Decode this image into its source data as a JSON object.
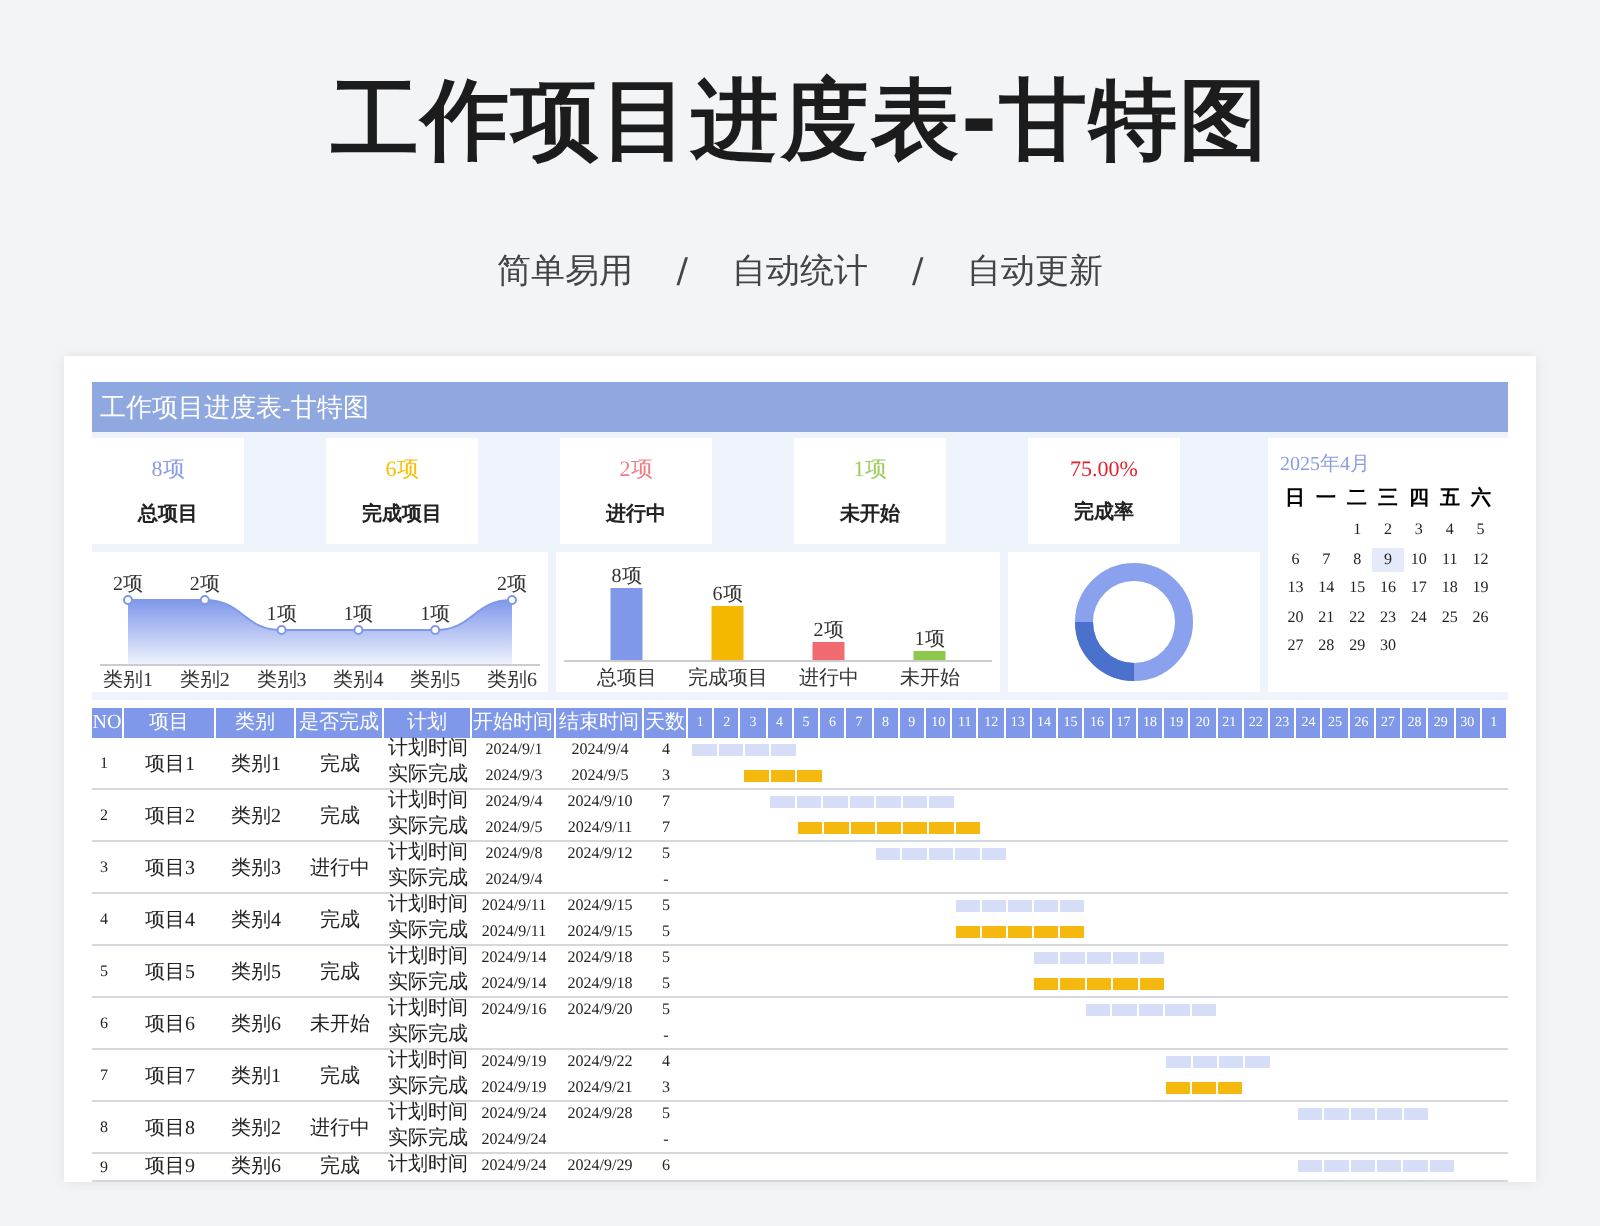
{
  "title": "工作项目进度表-甘特图",
  "subtitle": {
    "items": [
      "简单易用",
      "自动统计",
      "自动更新"
    ],
    "separator": "/"
  },
  "sheet_title": "工作项目进度表-甘特图",
  "stats": [
    {
      "value": "8项",
      "label": "总项目",
      "color": "#8c9be6"
    },
    {
      "value": "6项",
      "label": "完成项目",
      "color": "#f5c000"
    },
    {
      "value": "2项",
      "label": "进行中",
      "color": "#f07c86"
    },
    {
      "value": "1项",
      "label": "未开始",
      "color": "#9ccc5a"
    },
    {
      "value": "75.00%",
      "label": "完成率",
      "color": "#e0242c"
    }
  ],
  "calendar": {
    "title": "2025年4月",
    "weekdays": [
      "日",
      "一",
      "二",
      "三",
      "四",
      "五",
      "六"
    ],
    "weeks": [
      {
        "right_aligned": true,
        "days": [
          {
            "day": "1",
            "selected": false
          },
          {
            "day": "2",
            "selected": false
          },
          {
            "day": "3",
            "selected": false
          },
          {
            "day": "4",
            "selected": false
          },
          {
            "day": "5",
            "selected": false
          }
        ]
      },
      {
        "right_aligned": false,
        "days": [
          {
            "day": "6",
            "selected": false
          },
          {
            "day": "7",
            "selected": false
          },
          {
            "day": "8",
            "selected": false
          },
          {
            "day": "9",
            "selected": true
          },
          {
            "day": "10",
            "selected": false
          },
          {
            "day": "11",
            "selected": false
          },
          {
            "day": "12",
            "selected": false
          }
        ]
      },
      {
        "right_aligned": false,
        "days": [
          {
            "day": "13",
            "selected": false
          },
          {
            "day": "14",
            "selected": false
          },
          {
            "day": "15",
            "selected": false
          },
          {
            "day": "16",
            "selected": false
          },
          {
            "day": "17",
            "selected": false
          },
          {
            "day": "18",
            "selected": false
          },
          {
            "day": "19",
            "selected": false
          }
        ]
      },
      {
        "right_aligned": false,
        "days": [
          {
            "day": "20",
            "selected": false
          },
          {
            "day": "21",
            "selected": false
          },
          {
            "day": "22",
            "selected": false
          },
          {
            "day": "23",
            "selected": false
          },
          {
            "day": "24",
            "selected": false
          },
          {
            "day": "25",
            "selected": false
          },
          {
            "day": "26",
            "selected": false
          }
        ]
      },
      {
        "right_aligned": false,
        "days": [
          {
            "day": "27",
            "selected": false
          },
          {
            "day": "28",
            "selected": false
          },
          {
            "day": "29",
            "selected": false
          },
          {
            "day": "30",
            "selected": false
          }
        ]
      }
    ]
  },
  "category_chart": {
    "chart_data": {
      "type": "area",
      "categories": [
        "类别1",
        "类别2",
        "类别3",
        "类别4",
        "类别5",
        "类别6"
      ],
      "values": [
        2,
        2,
        1,
        1,
        1,
        2
      ],
      "value_labels": [
        "2项",
        "2项",
        "1项",
        "1项",
        "1项",
        "2项"
      ]
    }
  },
  "status_chart": {
    "chart_data": {
      "type": "bar",
      "categories": [
        "总项目",
        "完成项目",
        "进行中",
        "未开始"
      ],
      "values": [
        8,
        6,
        2,
        1
      ],
      "value_labels": [
        "8项",
        "6项",
        "2项",
        "1项"
      ],
      "colors": [
        "#7f98ea",
        "#f5b800",
        "#f06a70",
        "#8cc84b"
      ]
    }
  },
  "table": {
    "columns": [
      "NO",
      "项目",
      "类别",
      "是否完成",
      "计划",
      "开始时间",
      "结束时间",
      "天数"
    ],
    "days": [
      "1",
      "2",
      "3",
      "4",
      "5",
      "6",
      "7",
      "8",
      "9",
      "10",
      "11",
      "12",
      "13",
      "14",
      "15",
      "16",
      "17",
      "18",
      "19",
      "20",
      "21",
      "22",
      "23",
      "24",
      "25",
      "26",
      "27",
      "28",
      "29",
      "30",
      "1"
    ],
    "rows": [
      {
        "no": "1",
        "name": "项目1",
        "category": "类别1",
        "status": "完成",
        "plans": [
          {
            "kind": "plan",
            "label": "计划时间",
            "start": "2024/9/1",
            "end": "2024/9/4",
            "days": "4"
          },
          {
            "kind": "actual",
            "label": "实际完成",
            "start": "2024/9/3",
            "end": "2024/9/5",
            "days": "3"
          }
        ]
      },
      {
        "no": "2",
        "name": "项目2",
        "category": "类别2",
        "status": "完成",
        "plans": [
          {
            "kind": "plan",
            "label": "计划时间",
            "start": "2024/9/4",
            "end": "2024/9/10",
            "days": "7"
          },
          {
            "kind": "actual",
            "label": "实际完成",
            "start": "2024/9/5",
            "end": "2024/9/11",
            "days": "7"
          }
        ]
      },
      {
        "no": "3",
        "name": "项目3",
        "category": "类别3",
        "status": "进行中",
        "plans": [
          {
            "kind": "plan",
            "label": "计划时间",
            "start": "2024/9/8",
            "end": "2024/9/12",
            "days": "5"
          },
          {
            "kind": "actual",
            "label": "实际完成",
            "start": "2024/9/4",
            "days": "-"
          }
        ]
      },
      {
        "no": "4",
        "name": "项目4",
        "category": "类别4",
        "status": "完成",
        "plans": [
          {
            "kind": "plan",
            "label": "计划时间",
            "start": "2024/9/11",
            "end": "2024/9/15",
            "days": "5"
          },
          {
            "kind": "actual",
            "label": "实际完成",
            "start": "2024/9/11",
            "end": "2024/9/15",
            "days": "5"
          }
        ]
      },
      {
        "no": "5",
        "name": "项目5",
        "category": "类别5",
        "status": "完成",
        "plans": [
          {
            "kind": "plan",
            "label": "计划时间",
            "start": "2024/9/14",
            "end": "2024/9/18",
            "days": "5"
          },
          {
            "kind": "actual",
            "label": "实际完成",
            "start": "2024/9/14",
            "end": "2024/9/18",
            "days": "5"
          }
        ]
      },
      {
        "no": "6",
        "name": "项目6",
        "category": "类别6",
        "status": "未开始",
        "plans": [
          {
            "kind": "plan",
            "label": "计划时间",
            "start": "2024/9/16",
            "end": "2024/9/20",
            "days": "5"
          },
          {
            "kind": "actual",
            "label": "实际完成",
            "days": "-"
          }
        ]
      },
      {
        "no": "7",
        "name": "项目7",
        "category": "类别1",
        "status": "完成",
        "plans": [
          {
            "kind": "plan",
            "label": "计划时间",
            "start": "2024/9/19",
            "end": "2024/9/22",
            "days": "4"
          },
          {
            "kind": "actual",
            "label": "实际完成",
            "start": "2024/9/19",
            "end": "2024/9/21",
            "days": "3"
          }
        ]
      },
      {
        "no": "8",
        "name": "项目8",
        "category": "类别2",
        "status": "进行中",
        "plans": [
          {
            "kind": "plan",
            "label": "计划时间",
            "start": "2024/9/24",
            "end": "2024/9/28",
            "days": "5"
          },
          {
            "kind": "actual",
            "label": "实际完成",
            "start": "2024/9/24",
            "days": "-"
          }
        ]
      },
      {
        "no": "9",
        "name": "项目9",
        "category": "类别6",
        "status": "完成",
        "plans": [
          {
            "kind": "plan",
            "label": "计划时间",
            "start": "2024/9/24",
            "end": "2024/9/29",
            "days": "6"
          }
        ]
      }
    ]
  }
}
